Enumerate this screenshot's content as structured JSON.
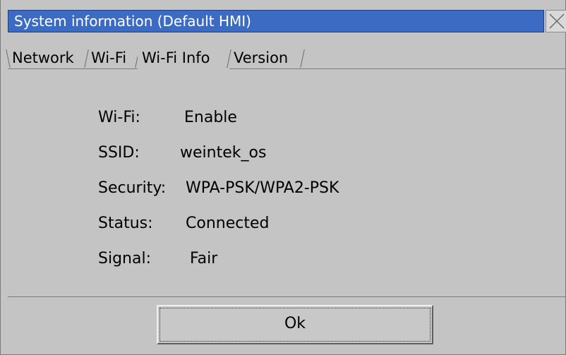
{
  "window": {
    "title": "System information (Default HMI)",
    "close_icon": "close-icon"
  },
  "tabs": [
    {
      "label": "Network",
      "active": false
    },
    {
      "label": "Wi-Fi",
      "active": false
    },
    {
      "label": "Wi-Fi Info",
      "active": true
    },
    {
      "label": "Version",
      "active": false
    }
  ],
  "wifi_info": {
    "wifi_label": "Wi-Fi:",
    "wifi_value": "Enable",
    "ssid_label": "SSID:",
    "ssid_value": "weintek_os",
    "security_label": "Security:",
    "security_value": "WPA-PSK/WPA2-PSK",
    "status_label": "Status:",
    "status_value": "Connected",
    "signal_label": "Signal:",
    "signal_value": "Fair"
  },
  "footer": {
    "ok_label": "Ok"
  },
  "colors": {
    "titlebar": "#3c6bc4",
    "background": "#c4c4c4"
  }
}
